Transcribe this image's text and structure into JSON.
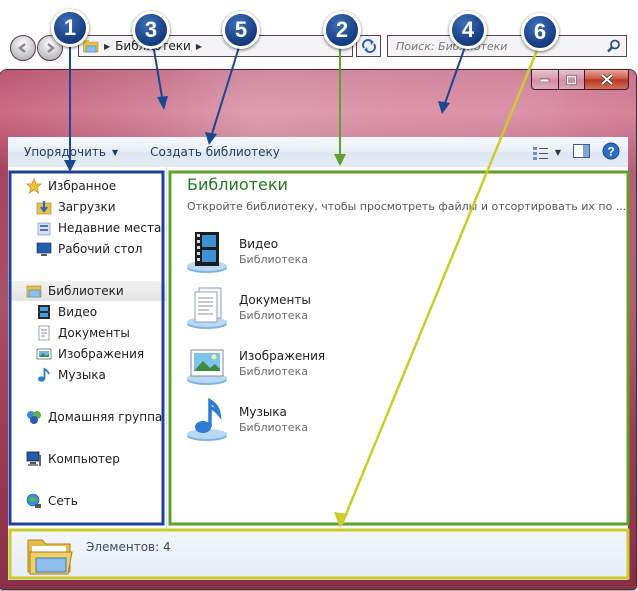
{
  "address": {
    "crumbs": [
      "Библиотеки"
    ],
    "search_placeholder": "Поиск: Библиотеки"
  },
  "toolbar": {
    "organize_label": "Упорядочить",
    "create_library_label": "Создать библиотеку"
  },
  "nav": {
    "favorites": "Избранное",
    "downloads": "Загрузки",
    "recent": "Недавние места",
    "desktop": "Рабочий стол",
    "libraries": "Библиотеки",
    "video": "Видео",
    "documents": "Документы",
    "pictures": "Изображения",
    "music": "Музыка",
    "homegroup": "Домашняя группа",
    "computer": "Компьютер",
    "network": "Сеть"
  },
  "main": {
    "title": "Библиотеки",
    "subtitle": "Откройте библиотеку, чтобы просмотреть файлы и отсортировать их по ...",
    "libraries": [
      {
        "name": "Видео",
        "type": "Библиотека",
        "icon": "video-library-icon"
      },
      {
        "name": "Документы",
        "type": "Библиотека",
        "icon": "documents-library-icon"
      },
      {
        "name": "Изображения",
        "type": "Библиотека",
        "icon": "pictures-library-icon"
      },
      {
        "name": "Музыка",
        "type": "Библиотека",
        "icon": "music-library-icon"
      }
    ]
  },
  "details": {
    "count_label": "Элементов: 4"
  },
  "callouts": [
    "1",
    "2",
    "3",
    "4",
    "5",
    "6"
  ],
  "colors": {
    "callout_blue": "#1b4790",
    "nav_pane_box": "#1f3f9c",
    "main_pane_box": "#5ea12a",
    "details_box": "#c9cc2c",
    "title_green": "#1f7a25"
  }
}
